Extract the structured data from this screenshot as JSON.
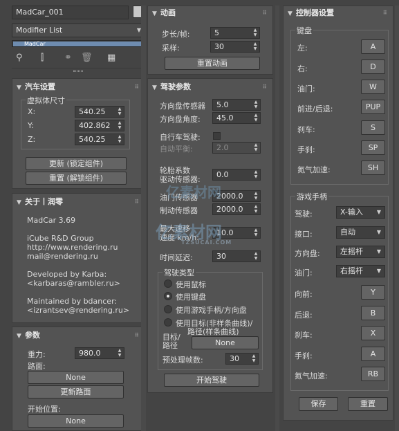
{
  "top": {
    "object_name": "MadCar_001",
    "modifier_list": "Modifier List",
    "stack_item": "MadCar"
  },
  "car_setup": {
    "title": "汽车设置",
    "virtual_size_label": "虚拟体尺寸",
    "x_label": "X:",
    "x_value": "540.25",
    "y_label": "Y:",
    "y_value": "402.862",
    "z_label": "Z:",
    "z_value": "540.25",
    "update_button": "更新 (锁定组件)",
    "reset_button": "重置 (解锁组件)"
  },
  "about": {
    "title": "关于丨润零",
    "lines": [
      "MadCar 3.69",
      "iCube R&D Group",
      "http://www.rendering.ru",
      "mail@rendering.ru",
      "Developed by Karba:",
      "<karbaras@rambler.ru>",
      "Maintained by bdancer:",
      "<izrantsev@rendering.ru>"
    ]
  },
  "params": {
    "title": "参数",
    "gravity_label": "重力:",
    "gravity_value": "980.0",
    "road_label": "路面:",
    "road_button": "None",
    "update_road_button": "更新路面",
    "start_pos_label": "开始位置:",
    "start_pos_button": "None"
  },
  "animation": {
    "title": "动画",
    "step_label": "步长/帧:",
    "step_value": "5",
    "sample_label": "采样:",
    "sample_value": "30",
    "reset_button": "重置动画"
  },
  "driving": {
    "title": "驾驶参数",
    "steer_sensor_label": "方向盘传感器",
    "steer_sensor_value": "5.0",
    "steer_angle_label": "方向盘角度:",
    "steer_angle_value": "45.0",
    "bike_label": "自行车驾驶:",
    "auto_balance_label": "自动平衡:",
    "auto_balance_value": "2.0",
    "wheel_coef_label_1": "轮胎系数",
    "wheel_coef_label_2": "驱动传感器:",
    "wheel_coef_value": "0.0",
    "throttle_label": "油门传感器",
    "throttle_value": "2000.0",
    "brake_label": "制动传感器",
    "brake_value": "2000.0",
    "max_speed_label_1": "最大速移",
    "max_speed_label_2": "速度 km/h:",
    "max_speed_value": "10.0",
    "delay_label": "时间延迟:",
    "delay_value": "30",
    "drive_type_label": "驾驶类型",
    "radio_mouse": "使用鼠标",
    "radio_keyboard": "使用键盘",
    "radio_gamepad": "使用游戏手柄/方向盘",
    "radio_target_1": "使用目标(非样条曲线)/",
    "radio_target_2": "路径(样条曲线)",
    "target_label_1": "目标/",
    "target_label_2": "路径",
    "target_button": "None",
    "precalc_label": "预处理帧数:",
    "precalc_value": "30",
    "start_button": "开始驾驶"
  },
  "controller": {
    "title": "控制器设置",
    "keyboard_group": "键盘",
    "keys": [
      {
        "label": "左:",
        "key": "A"
      },
      {
        "label": "右:",
        "key": "D"
      },
      {
        "label": "油门:",
        "key": "W"
      },
      {
        "label": "前进/后退:",
        "key": "PUP"
      },
      {
        "label": "刹车:",
        "key": "S"
      },
      {
        "label": "手刹:",
        "key": "SP"
      },
      {
        "label": "氮气加速:",
        "key": "SH"
      }
    ],
    "gamepad_group": "游戏手柄",
    "driver_label": "驾驶:",
    "driver_value": "X-输入",
    "port_label": "接口:",
    "port_value": "自动",
    "wheel_label": "方向盘:",
    "wheel_value": "左摇杆",
    "throttle_label": "油门:",
    "throttle_value": "右摇杆",
    "pad_keys": [
      {
        "label": "向前:",
        "key": "Y"
      },
      {
        "label": "后退:",
        "key": "B"
      },
      {
        "label": "刹车:",
        "key": "X"
      },
      {
        "label": "手刹:",
        "key": "A"
      },
      {
        "label": "氮气加速:",
        "key": "RB"
      }
    ],
    "save_button": "保存",
    "reset_button": "重置"
  },
  "watermark": {
    "line1": "亿素材网",
    "line2": "亿素材网",
    "line3": "TZSUCAI.COM"
  }
}
